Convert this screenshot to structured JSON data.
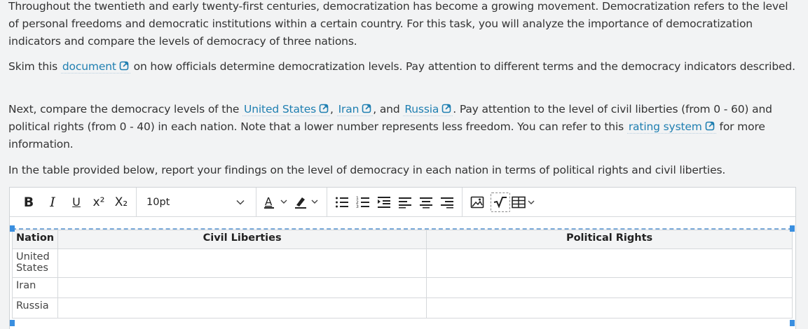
{
  "paragraphs": {
    "p1": "Throughout the twentieth and early twenty-first centuries, democratization has become a growing movement. Democratization refers to the level of personal freedoms and democratic institutions within a certain country. For this task, you will analyze the importance of democratization indicators and compare the levels of democracy of three nations.",
    "p2_pre": "Skim this ",
    "p2_link": "document",
    "p2_post": " on how officials determine democratization levels. Pay attention to different terms and the democracy indicators described.",
    "p3_pre": "Next, compare the democracy levels of the ",
    "p3_link1": "United States",
    "p3_sep1": ", ",
    "p3_link2": "Iran",
    "p3_sep2": ", and ",
    "p3_link3": "Russia",
    "p3_mid": ". Pay attention to the level of civil liberties (from 0 - 60) and political rights (from 0 - 40) in each nation. Note that a lower number represents less freedom. You can refer to this ",
    "p3_link4": "rating system",
    "p3_post": " for more information.",
    "p4": "In the table provided below, report your findings on the level of democracy in each nation in terms of political rights and civil liberties."
  },
  "toolbar": {
    "bold": "B",
    "italic": "I",
    "underline": "U",
    "superscript": "x²",
    "subscript": "X₂",
    "font_size": "10pt"
  },
  "table": {
    "headers": [
      "Nation",
      "Civil Liberties",
      "Political Rights"
    ],
    "rows": [
      [
        "United States",
        "",
        ""
      ],
      [
        "Iran",
        "",
        ""
      ],
      [
        "Russia",
        "",
        ""
      ]
    ]
  },
  "colors": {
    "link": "#1f7fb1",
    "selection": "#3a8fe0"
  }
}
